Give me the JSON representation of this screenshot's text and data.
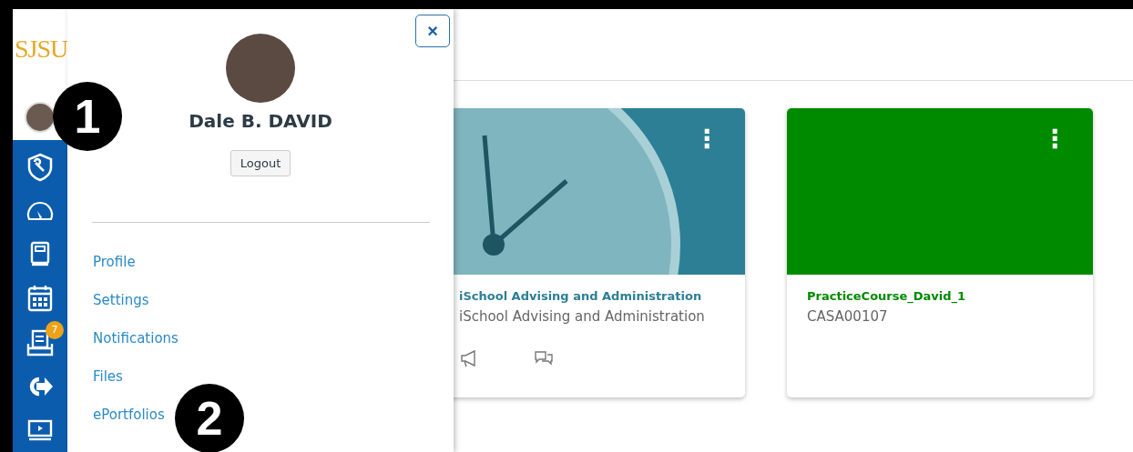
{
  "logo": "SJSU",
  "nav_items": [
    {
      "kind": "account"
    },
    {
      "kind": "admin"
    },
    {
      "kind": "dashboard"
    },
    {
      "kind": "courses"
    },
    {
      "kind": "calendar"
    },
    {
      "kind": "inbox",
      "badge": "7"
    },
    {
      "kind": "commons"
    },
    {
      "kind": "studio"
    }
  ],
  "account_tray": {
    "user_name": "Dale B. DAVID",
    "logout_button": "Logout",
    "close_button": "×",
    "links": [
      "Profile",
      "Settings",
      "Notifications",
      "Files",
      "ePortfolios"
    ]
  },
  "course_cards": [
    {
      "kind": "image",
      "title": "iSchool Advising and Administration",
      "subtitle": "iSchool Advising and Administration",
      "color": "#2d7f96",
      "menu": "⋮",
      "actions": [
        {
          "kind": "announcements"
        },
        {
          "kind": "discussions"
        }
      ]
    },
    {
      "kind": "color",
      "title": "PracticeCourse_David_1",
      "subtitle": "CASA00107",
      "color": "#008a00",
      "menu": "⋮"
    }
  ],
  "callouts": [
    {
      "label": "1"
    },
    {
      "label": "2"
    }
  ]
}
